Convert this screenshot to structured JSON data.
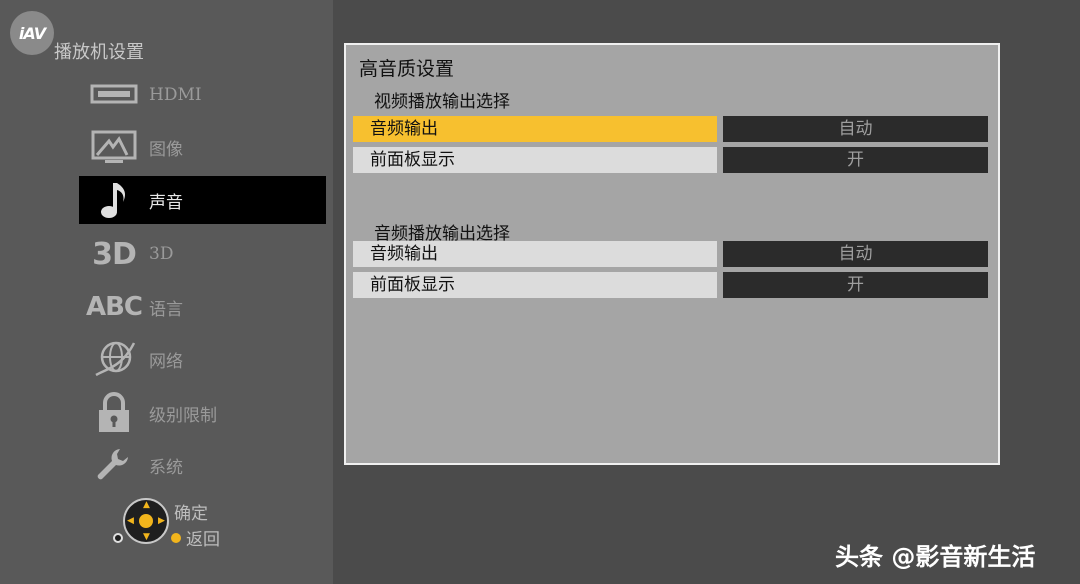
{
  "logo": {
    "text": "iAV"
  },
  "sidebar": {
    "title": "播放机设置",
    "items": [
      {
        "label": "HDMI",
        "icon": "hdmi-port-icon"
      },
      {
        "label": "图像",
        "icon": "monitor-icon"
      },
      {
        "label": "声音",
        "icon": "music-note-icon",
        "selected": true
      },
      {
        "label": "3D",
        "icon": "3d-text-icon",
        "icon_text": "3D"
      },
      {
        "label": "语言",
        "icon": "abc-text-icon",
        "icon_text": "ABC"
      },
      {
        "label": "网络",
        "icon": "globe-icon"
      },
      {
        "label": "级别限制",
        "icon": "lock-icon"
      },
      {
        "label": "系统",
        "icon": "wrench-icon"
      }
    ],
    "hints": {
      "confirm": "确定",
      "back": "返回"
    }
  },
  "panel": {
    "title": "高音质设置",
    "sections": [
      {
        "title": "视频播放输出选择",
        "rows": [
          {
            "label": "音频输出",
            "value": "自动"
          },
          {
            "label": "前面板显示",
            "value": "开"
          }
        ]
      },
      {
        "title": "音频播放输出选择",
        "rows": [
          {
            "label": "音频输出",
            "value": "自动"
          },
          {
            "label": "前面板显示",
            "value": "开"
          }
        ]
      }
    ]
  },
  "watermark": "头条 @影音新生活",
  "colors": {
    "focus": "#f7c02f",
    "selected_bg": "#000000",
    "accent_dot": "#f2b51c"
  }
}
